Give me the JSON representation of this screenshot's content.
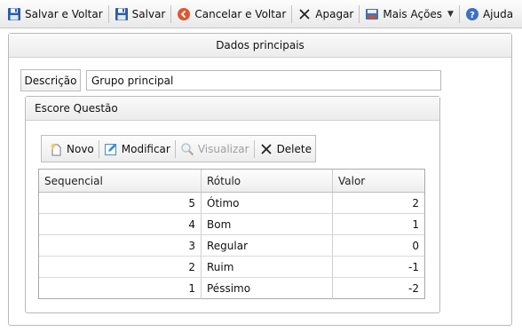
{
  "toolbar": {
    "save_back": "Salvar e Voltar",
    "save": "Salvar",
    "cancel_back": "Cancelar e Voltar",
    "delete": "Apagar",
    "more_actions": "Mais Ações",
    "help": "Ajuda"
  },
  "main_panel": {
    "title": "Dados principais",
    "description_label": "Descrição",
    "description_value": "Grupo principal"
  },
  "score_panel": {
    "title": "Escore Questão",
    "actions": {
      "new": "Novo",
      "modify": "Modificar",
      "view": "Visualizar",
      "delete": "Delete"
    },
    "columns": [
      "Sequencial",
      "Rótulo",
      "Valor"
    ],
    "rows": [
      {
        "seq": "5",
        "label": "Ótimo",
        "value": "2"
      },
      {
        "seq": "4",
        "label": "Bom",
        "value": "1"
      },
      {
        "seq": "3",
        "label": "Regular",
        "value": "0"
      },
      {
        "seq": "2",
        "label": "Ruim",
        "value": "-1"
      },
      {
        "seq": "1",
        "label": "Péssimo",
        "value": "-2"
      }
    ]
  },
  "colors": {
    "save_icon": "#2b5da8",
    "cancel_icon": "#e2552c",
    "help_icon": "#3d6fc4",
    "new_icon": "#f2c94c",
    "modify_icon": "#3e8ed0"
  }
}
